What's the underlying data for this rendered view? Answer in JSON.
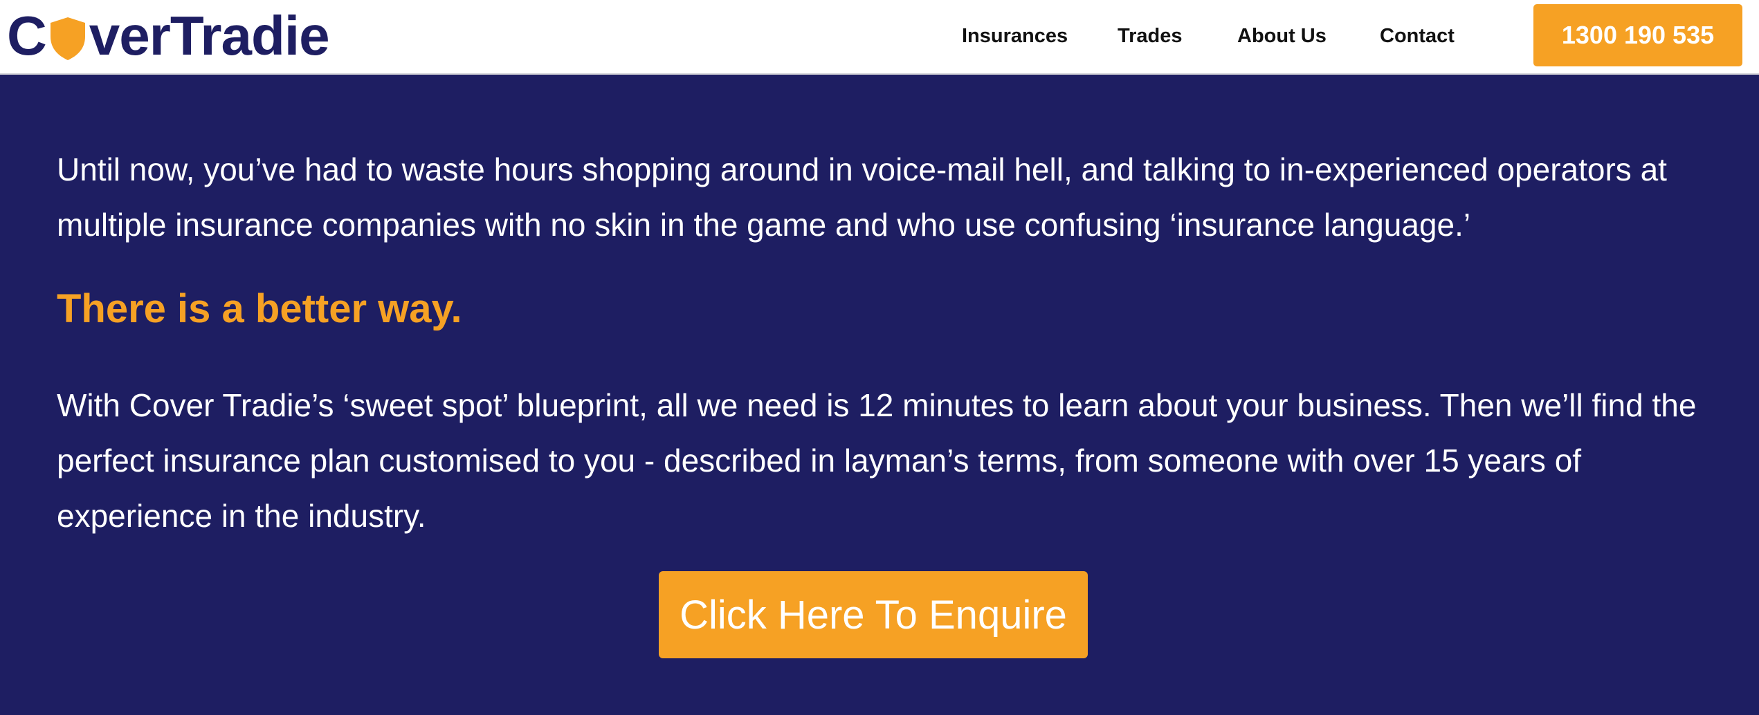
{
  "header": {
    "logo_text": "CoverTradie",
    "logo_prefix": "C",
    "logo_suffix": "verTradie",
    "nav": {
      "insurances": "Insurances",
      "trades": "Trades",
      "about": "About Us",
      "contact": "Contact"
    },
    "phone": "1300 190 535"
  },
  "main": {
    "intro": "Until now, you’ve had to waste hours shopping around in voice-mail hell, and talking to in-experienced operators at multiple insurance companies with no skin in the game and who use confusing ‘insurance language.’",
    "headline": "There is a better way.",
    "body": "With Cover Tradie’s ‘sweet spot’ blueprint, all we need is 12 minutes to learn about your business. Then we’ll find the perfect insurance plan customised to you - described in layman’s terms, from someone with over 15 years of experience in the industry.",
    "cta_label": "Click Here To Enquire"
  },
  "colors": {
    "brand_navy": "#1e1e62",
    "accent_orange": "#f6a124",
    "header_bg": "#ffffff"
  },
  "icons": {
    "logo_o": "shield-icon"
  }
}
